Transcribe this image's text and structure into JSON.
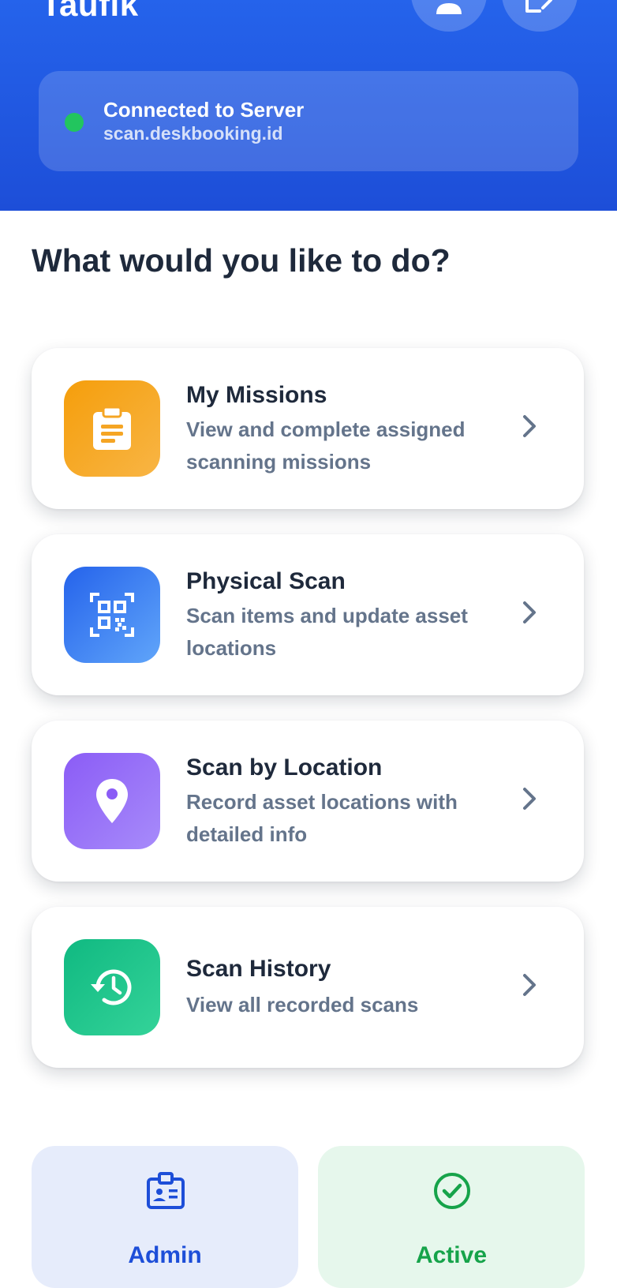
{
  "header": {
    "user_name": "Taufik",
    "profile_icon": "person-icon",
    "logout_icon": "logout-icon",
    "server": {
      "status_color": "#22c55e",
      "title": "Connected to Server",
      "url": "scan.deskbooking.id"
    }
  },
  "main": {
    "prompt": "What would you like to do?",
    "menu": [
      {
        "title": "My Missions",
        "description": "View and complete assigned scanning missions",
        "icon": "clipboard-icon",
        "color": "#f5a524"
      },
      {
        "title": "Physical Scan",
        "description": "Scan items and update asset locations",
        "icon": "qr-code-icon",
        "color": "#3b82f6"
      },
      {
        "title": "Scan by Location",
        "description": "Record asset locations with detailed info",
        "icon": "location-pin-icon",
        "color": "#8b5cf6"
      },
      {
        "title": "Scan History",
        "description": "View all recorded scans",
        "icon": "history-icon",
        "color": "#10b981"
      }
    ]
  },
  "badges": {
    "role": {
      "label": "Admin",
      "icon": "id-badge-icon",
      "color": "#1d4ed8"
    },
    "status": {
      "label": "Active",
      "icon": "check-circle-icon",
      "color": "#16a34a"
    }
  }
}
